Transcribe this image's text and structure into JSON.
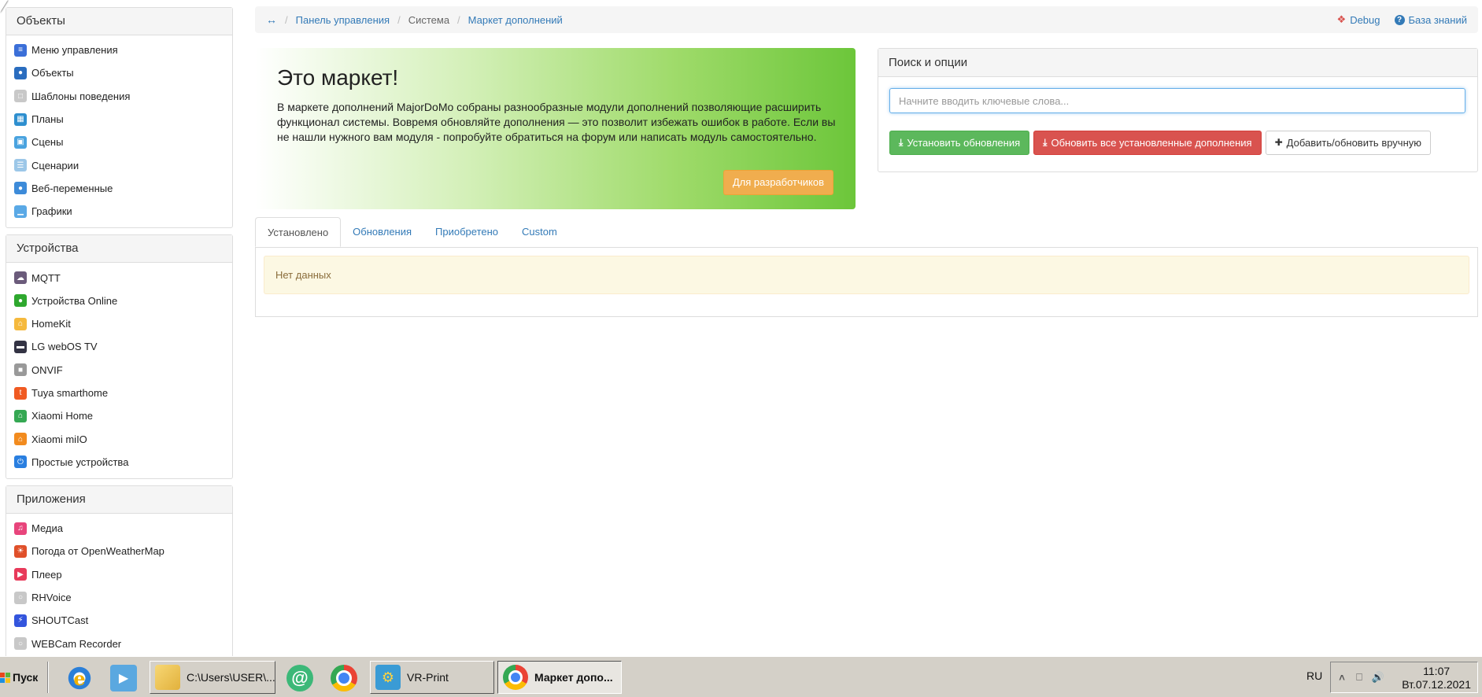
{
  "sidebar": {
    "objects": {
      "title": "Объекты",
      "items": [
        {
          "label": "Меню управления",
          "icon": "menu-icon",
          "color": "#3b6fd8"
        },
        {
          "label": "Объекты",
          "icon": "globe-icon",
          "color": "#2a6dbf"
        },
        {
          "label": "Шаблоны поведения",
          "icon": "template-icon",
          "color": "#c8c8c8"
        },
        {
          "label": "Планы",
          "icon": "plans-icon",
          "color": "#2e8fcf"
        },
        {
          "label": "Сцены",
          "icon": "scenes-icon",
          "color": "#4aa3df"
        },
        {
          "label": "Сценарии",
          "icon": "scenarios-icon",
          "color": "#9cc7e8"
        },
        {
          "label": "Веб-переменные",
          "icon": "web-globe-icon",
          "color": "#3d8bd9"
        },
        {
          "label": "Графики",
          "icon": "chart-icon",
          "color": "#5aa9e6"
        }
      ]
    },
    "devices": {
      "title": "Устройства",
      "items": [
        {
          "label": "MQTT",
          "icon": "mqtt-icon",
          "color": "#6b5b7b"
        },
        {
          "label": "Устройства Online",
          "icon": "online-icon",
          "color": "#2ea82e"
        },
        {
          "label": "HomeKit",
          "icon": "homekit-icon",
          "color": "#f5b93d"
        },
        {
          "label": "LG webOS TV",
          "icon": "tv-icon",
          "color": "#333344"
        },
        {
          "label": "ONVIF",
          "icon": "camera-icon",
          "color": "#999999"
        },
        {
          "label": "Tuya smarthome",
          "icon": "tuya-icon",
          "color": "#f05a22"
        },
        {
          "label": "Xiaomi Home",
          "icon": "xiaomi-home-icon",
          "color": "#35a853"
        },
        {
          "label": "Xiaomi miIO",
          "icon": "xiaomi-miio-icon",
          "color": "#f28b1e"
        },
        {
          "label": "Простые устройства",
          "icon": "power-icon",
          "color": "#2a7fe0"
        }
      ]
    },
    "apps": {
      "title": "Приложения",
      "items": [
        {
          "label": "Медиа",
          "icon": "music-icon",
          "color": "#e8457c"
        },
        {
          "label": "Погода от OpenWeatherMap",
          "icon": "weather-icon",
          "color": "#e0502a"
        },
        {
          "label": "Плеер",
          "icon": "player-icon",
          "color": "#e83a5a"
        },
        {
          "label": "RHVoice",
          "icon": "voice-icon",
          "color": "#c8c8c8"
        },
        {
          "label": "SHOUTCast",
          "icon": "shoutcast-icon",
          "color": "#3355dd"
        },
        {
          "label": "WEBCam Recorder",
          "icon": "webcam-icon",
          "color": "#c8c8c8"
        }
      ]
    }
  },
  "breadcrumb": {
    "home_icon": "arrows-horizontal-icon",
    "items": [
      {
        "label": "Панель управления",
        "link": true
      },
      {
        "label": "Система",
        "link": false
      },
      {
        "label": "Маркет дополнений",
        "link": true
      }
    ],
    "debug_label": "Debug",
    "kb_label": "База знаний"
  },
  "hero": {
    "title": "Это маркет!",
    "text": "В маркете дополнений MajorDoMo собраны разнообразные модули дополнений позволяющие расширить функционал системы. Вовремя обновляйте дополнения — это позволит избежать ошибок в работе. Если вы не нашли нужного вам модуля - попробуйте обратиться на форум или написать модуль самостоятельно.",
    "dev_button": "Для разработчиков"
  },
  "search": {
    "title": "Поиск и опции",
    "placeholder": "Начните вводить ключевые слова...",
    "value": "",
    "install_updates": "Установить обновления",
    "update_all": "Обновить все установленные дополнения",
    "add_manual": "Добавить/обновить вручную"
  },
  "tabs": {
    "items": [
      "Установлено",
      "Обновления",
      "Приобретено",
      "Custom"
    ],
    "active": 0
  },
  "content": {
    "empty_text": "Нет данных"
  },
  "taskbar": {
    "start_label": "Пуск",
    "tasks": [
      {
        "label": "C:\\Users\\USER\\...",
        "icon": "folder-icon"
      },
      {
        "label": "VR-Print",
        "icon": "vrprint-icon"
      },
      {
        "label": "Маркет допо...",
        "icon": "chrome-icon",
        "active": true
      }
    ],
    "language": "RU",
    "time": "11:07",
    "date": "Вт.07.12.2021"
  },
  "colors": {
    "link": "#337ab7",
    "success": "#5cb85c",
    "danger": "#d9534f",
    "warning": "#f0ad4e",
    "hero_green": "#6cc63a"
  }
}
